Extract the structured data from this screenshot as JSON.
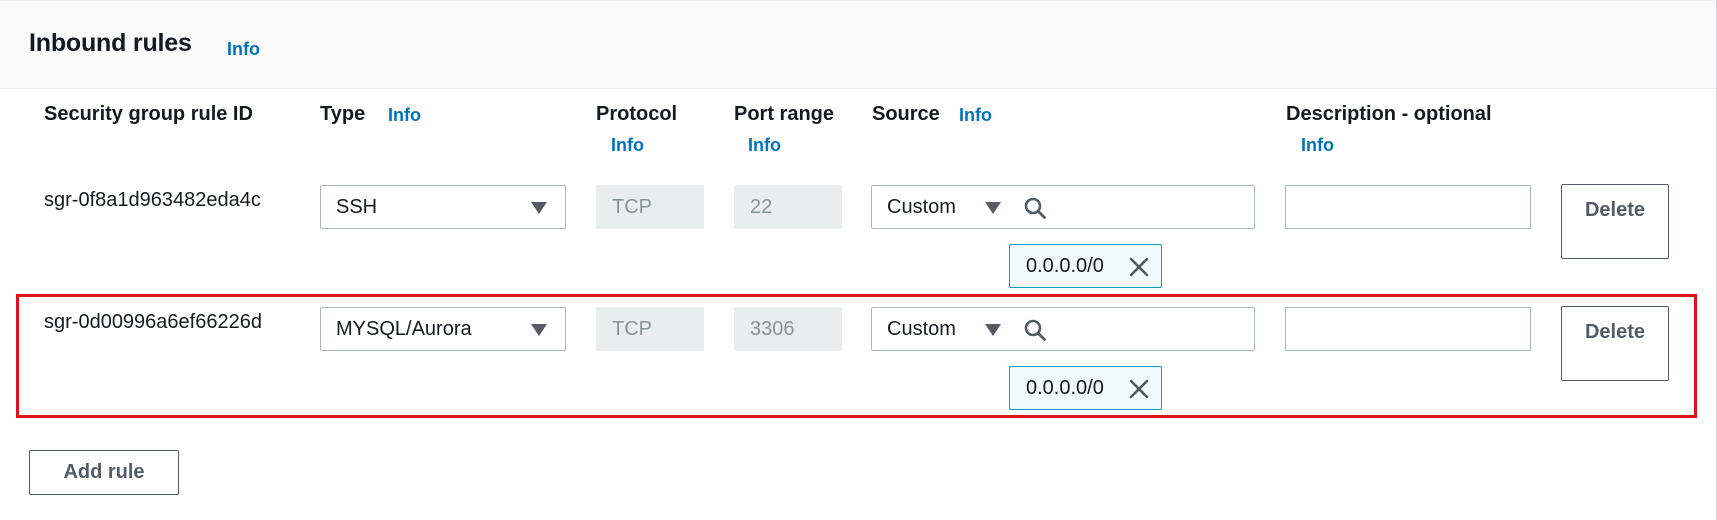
{
  "panel": {
    "title": "Inbound rules",
    "info_label": "Info"
  },
  "columns": {
    "rule_id": {
      "label": "Security group rule ID"
    },
    "type": {
      "label": "Type",
      "info": "Info"
    },
    "protocol": {
      "label": "Protocol",
      "info": "Info"
    },
    "port_range": {
      "label": "Port range",
      "info": "Info"
    },
    "source": {
      "label": "Source",
      "info": "Info"
    },
    "description": {
      "label": "Description - optional",
      "info": "Info"
    }
  },
  "rules": [
    {
      "id": "sgr-0f8a1d963482eda4c",
      "type": "SSH",
      "protocol": "TCP",
      "port_range": "22",
      "source_mode": "Custom",
      "source_search_value": "",
      "source_token": "0.0.0.0/0",
      "description": "",
      "delete_label": "Delete",
      "highlighted": false
    },
    {
      "id": "sgr-0d00996a6ef66226d",
      "type": "MYSQL/Aurora",
      "protocol": "TCP",
      "port_range": "3306",
      "source_mode": "Custom",
      "source_search_value": "",
      "source_token": "0.0.0.0/0",
      "description": "",
      "delete_label": "Delete",
      "highlighted": true
    }
  ],
  "add_rule_label": "Add rule",
  "colors": {
    "link": "#0073bb",
    "highlight_border": "#e0101d",
    "token_border": "#00a1c9",
    "token_bg": "#f1faff",
    "disabled_bg": "#eaeded"
  },
  "icons": {
    "select_caret": "caret-down-icon",
    "search": "search-icon",
    "token_remove": "close-icon"
  }
}
